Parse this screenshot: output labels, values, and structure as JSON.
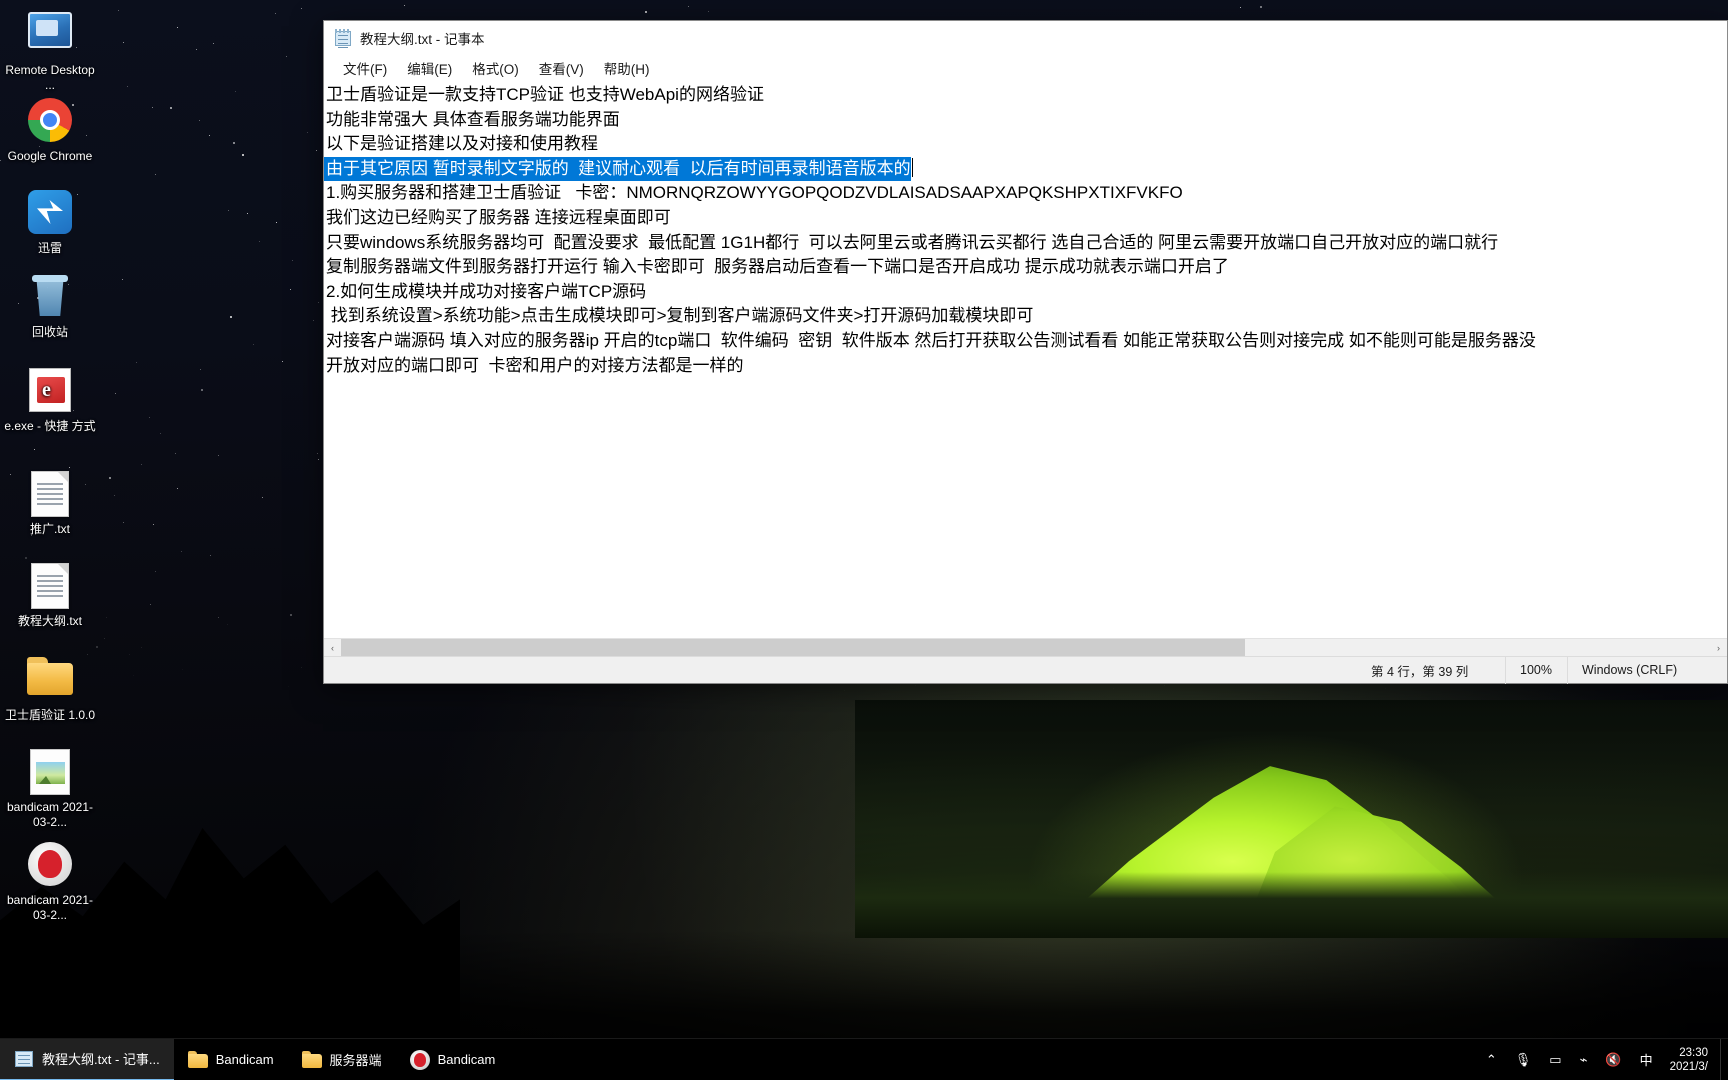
{
  "desktop": {
    "icons": [
      {
        "name": "remote-desktop",
        "label": "Remote\nDesktop ...",
        "icon": "remote-desktop-icon"
      },
      {
        "name": "google-chrome",
        "label": "Google\nChrome",
        "icon": "chrome-icon"
      },
      {
        "name": "xunlei",
        "label": "迅雷",
        "icon": "xunlei-icon"
      },
      {
        "name": "recycle-bin",
        "label": "回收站",
        "icon": "recycle-bin-icon"
      },
      {
        "name": "e-exe-shortcut",
        "label": "e.exe - 快捷\n方式",
        "icon": "exe-shortcut-icon"
      },
      {
        "name": "tuiguang-txt",
        "label": "推广.txt",
        "icon": "text-file-icon"
      },
      {
        "name": "jiaocheng-txt",
        "label": "教程大纲.txt",
        "icon": "text-file-icon"
      },
      {
        "name": "weishidun-folder",
        "label": "卫士盾验证\n1.0.0",
        "icon": "folder-icon"
      },
      {
        "name": "bandicam-image",
        "label": "bandicam\n2021-03-2...",
        "icon": "image-file-icon"
      },
      {
        "name": "bandicam-app",
        "label": "bandicam\n2021-03-2...",
        "icon": "bandicam-icon"
      }
    ]
  },
  "notepad": {
    "title": "教程大纲.txt - 记事本",
    "icon": "notepad-icon",
    "menus": [
      {
        "name": "file",
        "label": "文件(F)"
      },
      {
        "name": "edit",
        "label": "编辑(E)"
      },
      {
        "name": "format",
        "label": "格式(O)"
      },
      {
        "name": "view",
        "label": "查看(V)"
      },
      {
        "name": "help",
        "label": "帮助(H)"
      }
    ],
    "lines": [
      {
        "text": "卫士盾验证是一款支持TCP验证 也支持WebApi的网络验证",
        "selected": false
      },
      {
        "text": "功能非常强大 具体查看服务端功能界面",
        "selected": false
      },
      {
        "text": "以下是验证搭建以及对接和使用教程",
        "selected": false
      },
      {
        "text": "由于其它原因 暂时录制文字版的  建议耐心观看  以后有时间再录制语音版本的",
        "selected": true
      },
      {
        "text": "",
        "selected": false
      },
      {
        "text": "1.购买服务器和搭建卫士盾验证   卡密：NMORNQRZOWYYGOPQODZVDLAISADSAAPXAPQKSHPXTIXFVKFO",
        "selected": false
      },
      {
        "text": "我们这边已经购买了服务器 连接远程桌面即可",
        "selected": false
      },
      {
        "text": "只要windows系统服务器均可  配置没要求  最低配置 1G1H都行  可以去阿里云或者腾讯云买都行 选自己合适的 阿里云需要开放端口自己开放对应的端口就行",
        "selected": false
      },
      {
        "text": "复制服务器端文件到服务器打开运行 输入卡密即可  服务器启动后查看一下端口是否开启成功 提示成功就表示端口开启了",
        "selected": false
      },
      {
        "text": "",
        "selected": false
      },
      {
        "text": "",
        "selected": false
      },
      {
        "text": "2.如何生成模块并成功对接客户端TCP源码",
        "selected": false
      },
      {
        "text": " 找到系统设置>系统功能>点击生成模块即可>复制到客户端源码文件夹>打开源码加载模块即可",
        "selected": false
      },
      {
        "text": "对接客户端源码 填入对应的服务器ip 开启的tcp端口  软件编码  密钥  软件版本 然后打开获取公告测试看看 如能正常获取公告则对接完成 如不能则可能是服务器没",
        "selected": false
      },
      {
        "text": "开放对应的端口即可  卡密和用户的对接方法都是一样的",
        "selected": false
      }
    ],
    "scrollbar": {
      "left_arrow": "‹",
      "right_arrow": "›"
    },
    "status": {
      "position": "第 4 行，第 39 列",
      "zoom": "100%",
      "line_ending": "Windows (CRLF)"
    },
    "selection_color": "#0078d7"
  },
  "taskbar": {
    "items": [
      {
        "name": "taskbar-notepad",
        "label": "教程大纲.txt - 记事...",
        "icon": "notepad-icon",
        "active": true
      },
      {
        "name": "taskbar-bandicam",
        "label": "Bandicam",
        "icon": "folder-icon",
        "active": false
      },
      {
        "name": "taskbar-server",
        "label": "服务器端",
        "icon": "folder-icon",
        "active": false
      },
      {
        "name": "taskbar-bandicam-app",
        "label": "Bandicam",
        "icon": "bandicam-icon",
        "active": false
      }
    ],
    "tray": [
      {
        "name": "tray-chevron-up",
        "icon": "chevron-up-icon",
        "glyph": "⌃"
      },
      {
        "name": "tray-microphone",
        "icon": "microphone-icon",
        "glyph": "🎙"
      },
      {
        "name": "tray-battery",
        "icon": "battery-icon",
        "glyph": "▭"
      },
      {
        "name": "tray-network",
        "icon": "wifi-icon",
        "glyph": "⌁"
      },
      {
        "name": "tray-volume",
        "icon": "speaker-mute-icon",
        "glyph": "🔇"
      },
      {
        "name": "tray-ime",
        "icon": "ime-icon",
        "glyph": "中"
      }
    ],
    "clock": {
      "time": "23:30",
      "date": "2021/3/"
    }
  }
}
